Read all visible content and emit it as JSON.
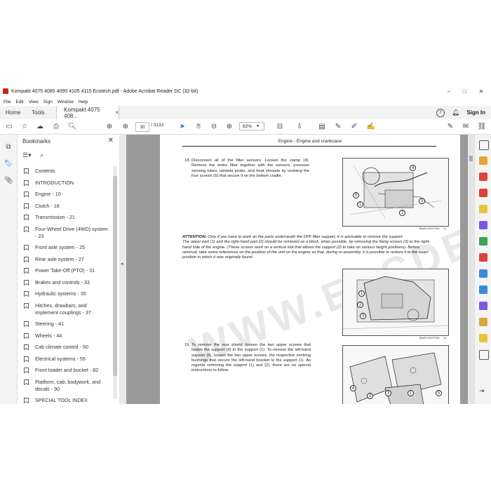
{
  "window": {
    "title": "Kompakt 4075 4085 4095 4105 4115 Ecotech.pdf - Adobe Acrobat Reader DC (32-bit)",
    "minimize": "–",
    "maximize": "□",
    "close": "✕"
  },
  "menu": [
    "File",
    "Edit",
    "View",
    "Sign",
    "Window",
    "Help"
  ],
  "tabs": {
    "home": "Home",
    "tools": "Tools",
    "document": "Kompakt 4075 408...",
    "doc_close": "×",
    "sign_in": "Sign In"
  },
  "toolbar": {
    "page_current": "30",
    "page_total": "/ 3133",
    "zoom": "82%"
  },
  "bookmarks": {
    "title": "Bookmarks",
    "items": [
      "Contents",
      "INTRODUCTION",
      "Engine - 10",
      "Clutch - 18",
      "Transmission - 21",
      "Four-Wheel Drive (4WD) system - 23",
      "Front axle system - 25",
      "Rear axle system - 27",
      "Power Take-Off (PTO) - 31",
      "Brakes and controls - 33",
      "Hydraulic systems - 35",
      "Hitches, drawbars, and implement couplings - 37",
      "Steering - 41",
      "Wheels - 44",
      "Cab climate control - 50",
      "Electrical systems - 55",
      "Front loader and bucket - 82",
      "Platform, cab, bodywork, and decals - 90",
      "SPECIAL TOOL INDEX"
    ]
  },
  "page": {
    "header": "Engine - Engine and crankcase",
    "step18_num": "18.",
    "step18": "Disconnect all of the filter sensors. Loosen the clamp (4). Remove the entire filter together with the sensors, pressure sensing tubes, lambda probe, and heat shrouds by undoing the four screws (5) that secure it on the bottom cradle.",
    "fig1_caption": "BAAPL40107C5A",
    "fig1_num": "15",
    "attention_label": "ATTENTION:",
    "attention_text": "Only if you have to work on the parts underneath the DPF filter support, it is advisable to remove the support.",
    "attention_text2": "The upper part (1) and the right-hand part (2) should be removed as a block, when possible, by removing the fixing screws (3) to the right-hand side of the engine. (These screws work on a vertical slot that allows the support (2) to take on various height positions). Before removal, take some references on the position of the unit on the engine so that, during re-assembly, it is possible to restore it to the exact position in which it was originally found.",
    "fig2_caption": "BAAPL40107C5A",
    "fig2_num": "16",
    "step19_num": "19.",
    "step19": "To remove the rear shield, loosen the two upper screws that fasten the support (4) to the support (1). To remove the left-hand support (5), loosen the two upper screws, the respective centring bushings that secure the left-hand bracket to the support (1). As regards removing the support (1) and (2), there are no special instructions to follow.",
    "callouts_fig1": [
      "4",
      "5",
      "1",
      "2",
      "3"
    ],
    "callouts_fig2": [
      "1",
      "2",
      "3"
    ],
    "callouts_fig3": [
      "4",
      "2",
      "3",
      "1",
      "5"
    ],
    "watermark": "WWW.EPCDEPOT.COM"
  }
}
